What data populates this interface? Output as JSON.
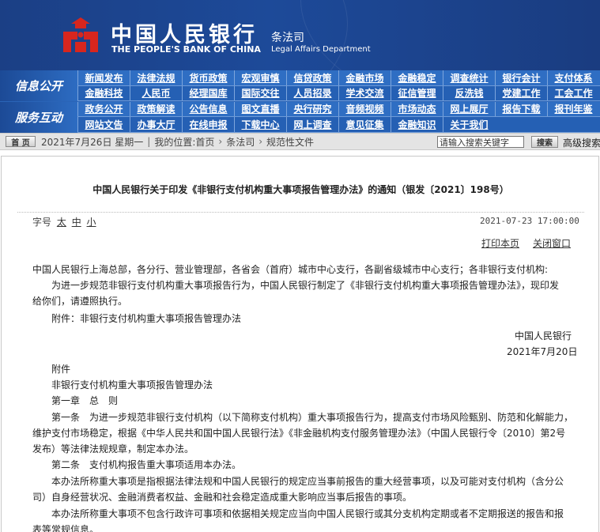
{
  "header": {
    "cn_name": "中国人民银行",
    "en_name": "THE PEOPLE'S BANK OF CHINA",
    "dept_cn": "条法司",
    "dept_en": "Legal Affairs Department",
    "logo_icon": "pboc-logo-icon",
    "brand_color": "#1d4a99",
    "logo_color": "#d7261e"
  },
  "nav": {
    "info_label": "信息公开",
    "service_label": "服务互动",
    "rows": [
      [
        "新闻发布",
        "法律法规",
        "货币政策",
        "宏观审慎",
        "信贷政策",
        "金融市场",
        "金融稳定",
        "调查统计",
        "银行会计",
        "支付体系"
      ],
      [
        "金融科技",
        "人民币",
        "经理国库",
        "国际交往",
        "人员招录",
        "学术交流",
        "征信管理",
        "反洗钱",
        "党建工作",
        "工会工作"
      ],
      [
        "政务公开",
        "政策解读",
        "公告信息",
        "图文直播",
        "央行研究",
        "音频视频",
        "市场动态",
        "网上展厅",
        "报告下载",
        "报刊年鉴"
      ],
      [
        "网站文告",
        "办事大厅",
        "在线申报",
        "下载中心",
        "网上调查",
        "意见征集",
        "金融知识",
        "关于我们"
      ]
    ]
  },
  "locbar": {
    "home_label": "首 页",
    "date": "2021年7月26日 星期一",
    "location_prefix": "我的位置:",
    "crumbs": [
      "首页",
      "条法司",
      "规范性文件"
    ],
    "search_placeholder": "请输入搜索关键字",
    "search_button": "搜索",
    "advanced_search": "高级搜索"
  },
  "article": {
    "title": "中国人民银行关于印发《非银行支付机构重大事项报告管理办法》的通知（银发〔2021〕198号）",
    "font_label": "字号",
    "font_sizes": [
      "太",
      "中",
      "小"
    ],
    "pubdate": "2021-07-23 17:00:00",
    "print_label": "打印本页",
    "close_label": "关闭窗口",
    "lines": [
      "中国人民银行上海总部，各分行、营业管理部，各省会（首府）城市中心支行，各副省级城市中心支行；各非银行支付机构:",
      "为进一步规范非银行支付机构重大事项报告行为，中国人民银行制定了《非银行支付机构重大事项报告管理办法》，现印发",
      "给你们，请遵照执行。",
      "附件：非银行支付机构重大事项报告管理办法",
      "中国人民银行",
      "2021年7月20日",
      "附件",
      "非银行支付机构重大事项报告管理办法",
      "第一章　总　则",
      "第一条　为进一步规范非银行支付机构（以下简称支付机构）重大事项报告行为，提高支付市场风险甄别、防范和化解能力，",
      "维护支付市场稳定，根据《中华人民共和国中国人民银行法》《非金融机构支付服务管理办法》（中国人民银行令〔2010〕第2号",
      "发布）等法律法规规章，制定本办法。",
      "第二条　支付机构报告重大事项适用本办法。",
      "本办法所称重大事项是指根据法律法规和中国人民银行的规定应当事前报告的重大经营事项，以及可能对支付机构（含分公",
      "司）自身经营状况、金融消费者权益、金融和社会稳定造成重大影响应当事后报告的事项。",
      "本办法所称重大事项不包含行政许可事项和依据相关规定应当向中国人民银行或其分支机构定期或者不定期报送的报告和报",
      "表等常规信息。"
    ]
  }
}
